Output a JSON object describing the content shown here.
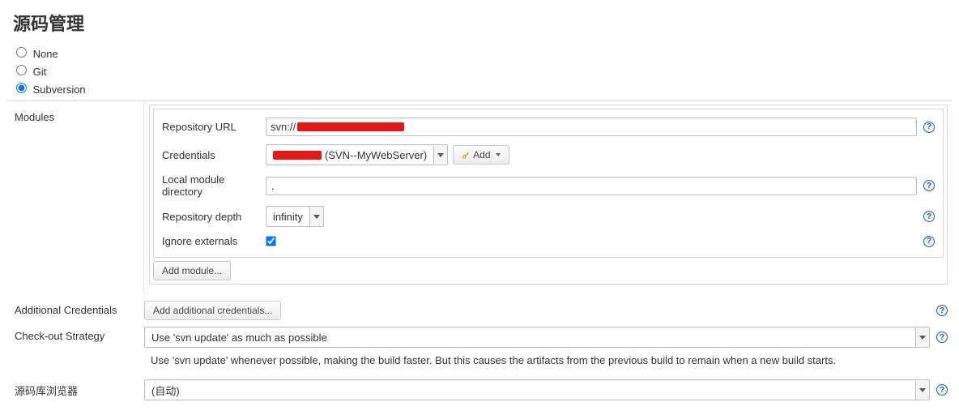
{
  "page_title": "源码管理",
  "scm": {
    "options": {
      "none": "None",
      "git": "Git",
      "subversion": "Subversion"
    },
    "selected": "subversion"
  },
  "sidebar": {
    "modules": "Modules"
  },
  "module": {
    "labels": {
      "repo_url": "Repository URL",
      "credentials": "Credentials",
      "local_dir": "Local module directory",
      "depth": "Repository depth",
      "ignore_externals": "Ignore externals"
    },
    "repo_url_prefix": "svn://",
    "credentials_suffix": "(SVN--MyWebServer)",
    "local_dir_value": ".",
    "depth_value": "infinity",
    "ignore_externals_checked": true,
    "add_btn": "Add"
  },
  "buttons": {
    "add_module": "Add module...",
    "add_additional_credentials": "Add additional credentials..."
  },
  "sections": {
    "additional_credentials": "Additional Credentials",
    "checkout_strategy": "Check-out Strategy",
    "repo_browser": "源码库浏览器"
  },
  "checkout": {
    "selected": "Use 'svn update' as much as possible",
    "description": "Use 'svn update' whenever possible, making the build faster. But this causes the artifacts from the previous build to remain when a new build starts."
  },
  "browser": {
    "selected": "(自动)"
  }
}
